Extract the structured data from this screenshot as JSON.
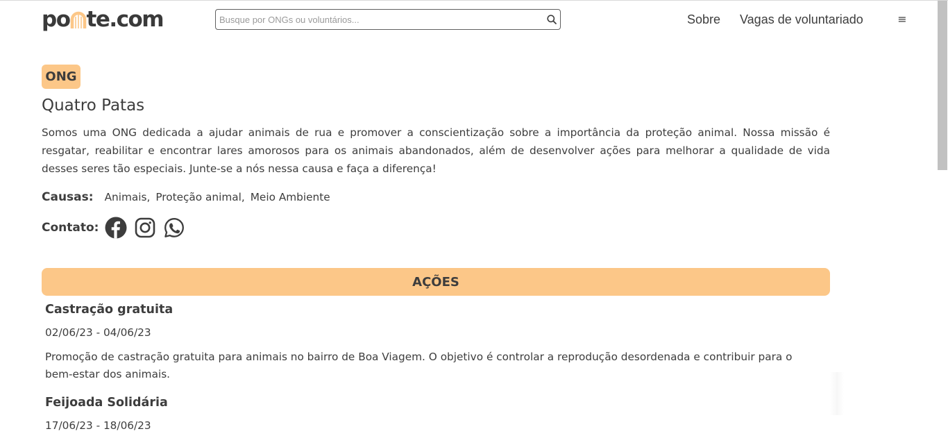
{
  "header": {
    "logo_prefix": "po",
    "logo_suffix": "te.com",
    "search_placeholder": "Busque por ONGs ou voluntários...",
    "nav": {
      "about": "Sobre",
      "vagas": "Vagas de voluntariado"
    },
    "menu_glyph": "≡"
  },
  "org": {
    "badge": "ONG",
    "name": "Quatro Patas",
    "description": "Somos uma ONG dedicada a ajudar animais de rua e promover a conscientização sobre a importância da proteção animal. Nossa missão é resgatar, reabilitar e encontrar lares amorosos para os animais abandonados, além de desenvolver ações para melhorar a qualidade de vida desses seres tão especiais. Junte-se a nós nessa causa e faça a diferença!",
    "causes_label": "Causas:",
    "causes": [
      "Animais,",
      "Proteção animal,",
      "Meio Ambiente"
    ],
    "contact_label": "Contato:",
    "contact_icons": [
      "facebook-icon",
      "instagram-icon",
      "whatsapp-icon"
    ]
  },
  "actions": {
    "section_title": "AÇÕES",
    "items": [
      {
        "title": "Castração gratuita",
        "dates": "02/06/23 - 04/06/23",
        "description": "Promoção de castração gratuita para animais no bairro de Boa Viagem. O objetivo é controlar a reprodução desordenada e contribuir para o bem-estar dos animais."
      },
      {
        "title": "Feijoada Solidária",
        "dates": "17/06/23 - 18/06/23"
      }
    ]
  },
  "colors": {
    "accent": "#fcc788",
    "text": "#3d3d3d",
    "logo_arch": "#fcc788"
  }
}
